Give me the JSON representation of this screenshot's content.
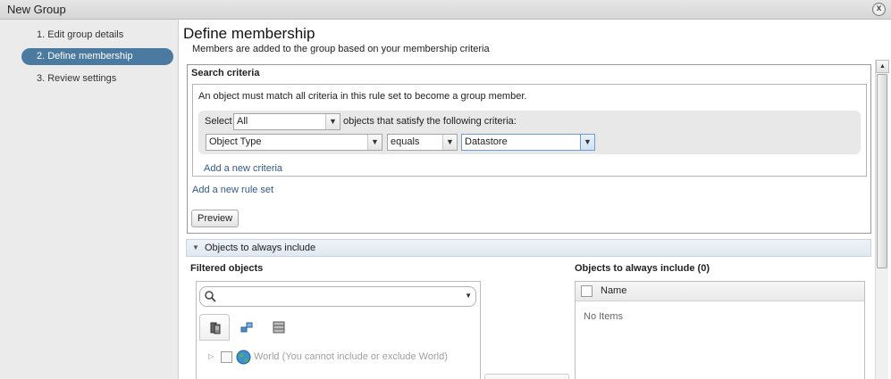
{
  "window": {
    "title": "New Group",
    "close_glyph": "x"
  },
  "sidebar": {
    "steps": [
      {
        "label": "1. Edit group details",
        "active": false
      },
      {
        "label": "2. Define membership",
        "active": true
      },
      {
        "label": "3. Review settings",
        "active": false
      }
    ]
  },
  "main": {
    "title": "Define membership",
    "subtitle": "Members are added to the group based on your membership criteria"
  },
  "search_criteria": {
    "header": "Search criteria",
    "rule_description": "An object must match all criteria in this rule set to become a group member.",
    "select_prefix": "Select",
    "match_mode": "All",
    "select_suffix": "objects that satisfy the following criteria:",
    "criteria": [
      {
        "property": "Object Type",
        "operator": "equals",
        "value": "Datastore"
      }
    ],
    "add_criteria_link": "Add a new criteria",
    "add_rule_set_link": "Add a new rule set",
    "preview_button": "Preview"
  },
  "include_section": {
    "header": "Objects to always include",
    "expanded": true
  },
  "filtered_objects": {
    "header": "Filtered objects",
    "search_placeholder": "",
    "tabs": [
      "hosts-clusters-icon",
      "networks-icon",
      "storage-icon"
    ],
    "tree": [
      {
        "label": "World (You cannot include or exclude World)",
        "disabled": true
      }
    ]
  },
  "always_include": {
    "header": "Objects to always include (0)",
    "column_name": "Name",
    "empty_text": "No Items"
  },
  "colors": {
    "accent": "#4b7aa0",
    "link": "#2f5a8a",
    "sidebar_bg": "#ebebeb"
  }
}
